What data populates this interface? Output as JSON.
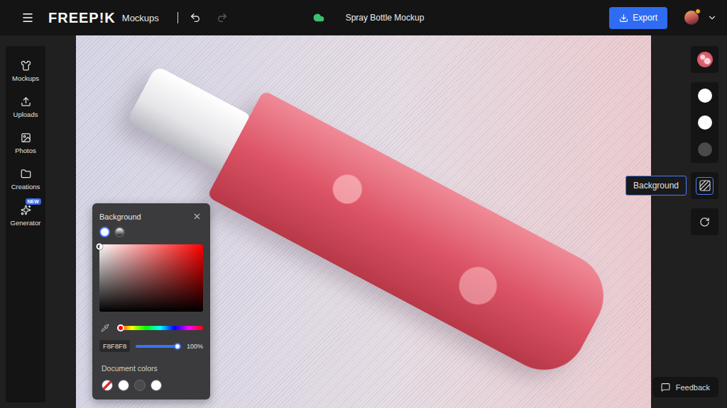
{
  "topbar": {
    "logo": "FREEP!K",
    "product": "Mockups",
    "undo": {
      "disabled": false
    },
    "redo": {
      "disabled": true
    },
    "document_title": "Spray Bottle Mockup",
    "saved": true,
    "export": "Export"
  },
  "sidebar": {
    "items": [
      {
        "label": "Mockups",
        "selected": false
      },
      {
        "label": "Uploads",
        "selected": false
      },
      {
        "label": "Photos",
        "selected": false
      },
      {
        "label": "Creations",
        "selected": false
      },
      {
        "label": "Generator",
        "selected": false,
        "badge": "NEW"
      }
    ]
  },
  "tools": {
    "groups": [
      [
        {
          "kind": "design",
          "selected": false
        }
      ],
      [
        {
          "kind": "color",
          "color": "#ffffff",
          "selected": false
        },
        {
          "kind": "color",
          "color": "#ffffff",
          "selected": false
        },
        {
          "kind": "color",
          "color": "#4a4a4a",
          "selected": false
        }
      ],
      [
        {
          "kind": "background",
          "selected": true,
          "tooltip": "Background"
        }
      ],
      [
        {
          "kind": "reset",
          "selected": false
        }
      ]
    ]
  },
  "color_picker": {
    "title": "Background",
    "modes": [
      {
        "kind": "solid",
        "selected": true
      },
      {
        "kind": "gradient",
        "selected": false
      }
    ],
    "saturation": 0.0,
    "brightness": 0.97,
    "hue": 0.0,
    "hex": "F8F8F8",
    "opacity": {
      "level": 1.0,
      "reading": "100%"
    },
    "document_colors_label": "Document colors",
    "document_colors": [
      {
        "kind": "none"
      },
      {
        "kind": "swatch",
        "color": "#ffffff"
      },
      {
        "kind": "swatch",
        "color": "#4a4a4c"
      },
      {
        "kind": "swatch",
        "color": "#ffffff"
      }
    ]
  },
  "feedback": "Feedback"
}
